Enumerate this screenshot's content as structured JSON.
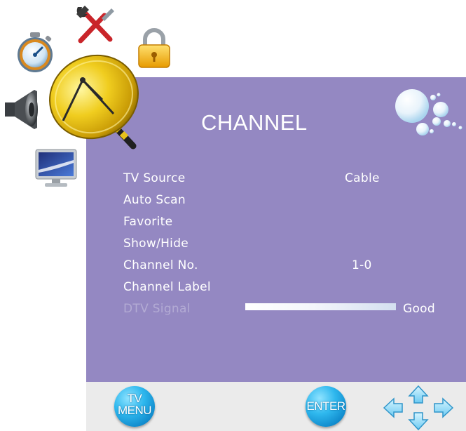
{
  "menu": {
    "title": "CHANNEL",
    "items": [
      {
        "label": "TV Source",
        "value": "Cable"
      },
      {
        "label": "Auto Scan",
        "value": ""
      },
      {
        "label": "Favorite",
        "value": ""
      },
      {
        "label": "Show/Hide",
        "value": ""
      },
      {
        "label": "Channel No.",
        "value": "1-0"
      },
      {
        "label": "Channel Label",
        "value": ""
      },
      {
        "label": "DTV Signal",
        "value": "Good",
        "disabled": true
      }
    ]
  },
  "footer": {
    "menu_button": {
      "line1": "TV",
      "line2": "MENU"
    },
    "enter_button": "ENTER"
  },
  "icons": [
    "timer-icon",
    "tools-icon",
    "lock-icon",
    "speaker-icon",
    "satellite-dish-icon",
    "monitor-icon",
    "bubbles-icon",
    "arrow-pad-icon"
  ],
  "colors": {
    "panel": "#9488c2",
    "footer": "#ebebeb",
    "button": "#2fb8ee",
    "dish": "#e9c21a"
  }
}
